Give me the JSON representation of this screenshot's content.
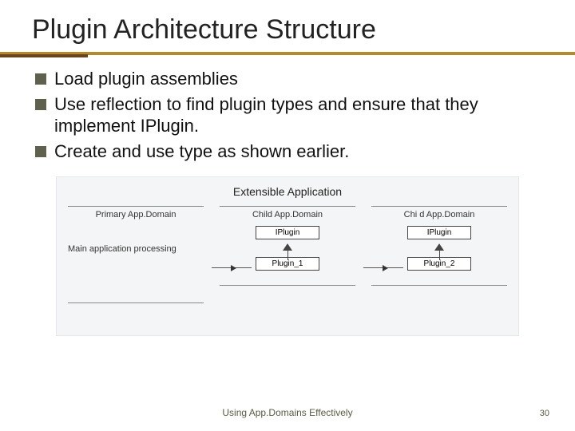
{
  "title": "Plugin Architecture Structure",
  "bullets": [
    "Load plugin assemblies",
    "Use reflection to find plugin types and ensure that they implement IPlugin.",
    "Create and use type as shown earlier."
  ],
  "diagram": {
    "title": "Extensible Application",
    "primary": {
      "label": "Primary App.Domain",
      "text": "Main application processing"
    },
    "child1": {
      "label": "Child App.Domain",
      "iplugin": "IPlugin",
      "plugin": "Plugin_1"
    },
    "child2": {
      "label": "Chi d App.Domain",
      "iplugin": "IPlugin",
      "plugin": "Plugin_2"
    }
  },
  "footer": "Using App.Domains Effectively",
  "page": "30"
}
